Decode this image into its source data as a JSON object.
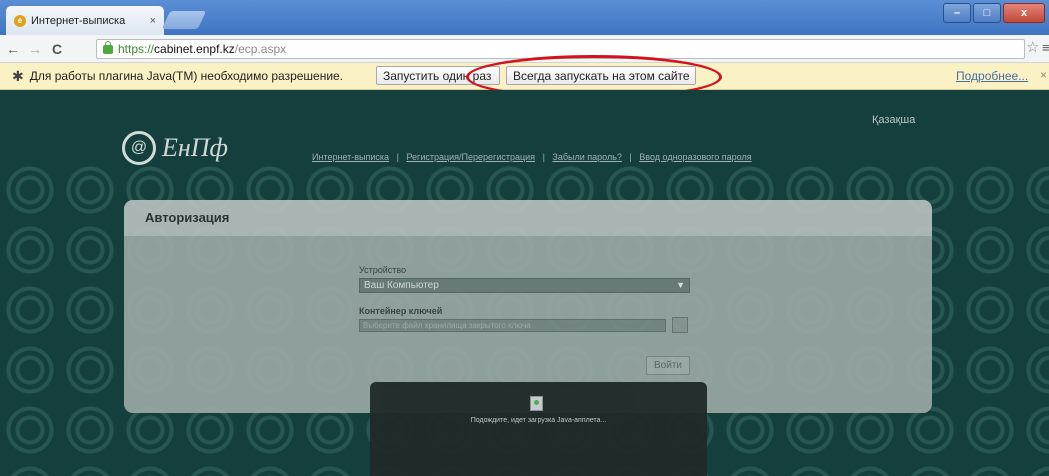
{
  "browser": {
    "tab_title": "Интернет-выписка",
    "tab_close": "×",
    "url_scheme": "https://",
    "url_host": "cabinet.enpf.kz",
    "url_path": "/ecp.aspx",
    "win_min": "–",
    "win_max": "□",
    "win_close": "x"
  },
  "infobar": {
    "message": "Для работы плагина Java(TM) необходимо разрешение.",
    "run_once_label": "Запустить один раз",
    "always_run_label": "Всегда запускать на этом сайте",
    "more_label": "Подробнее...",
    "close": "×"
  },
  "site": {
    "logo_text": "ЕнПф",
    "lang_link": "Қазақша",
    "links": [
      "Интернет-выписка",
      "Регистрация/Перерегистрация",
      "Забыли пароль?",
      "Ввод одноразового пароля"
    ],
    "separator": "|"
  },
  "auth": {
    "title": "Авторизация",
    "device_label": "Устройство",
    "device_value": "Ваш Компьютер",
    "container_label": "Контейнер ключей",
    "file_placeholder": "Выберите файл хранилища закрытого ключа",
    "login_label": "Войти"
  },
  "overlay": {
    "wait_text": "Подождите, идет загрузка Java-апплета..."
  },
  "colors": {
    "alert_oval": "#d4121b",
    "page_bg": "#143f3c",
    "infobar_bg": "#faf2c4"
  }
}
